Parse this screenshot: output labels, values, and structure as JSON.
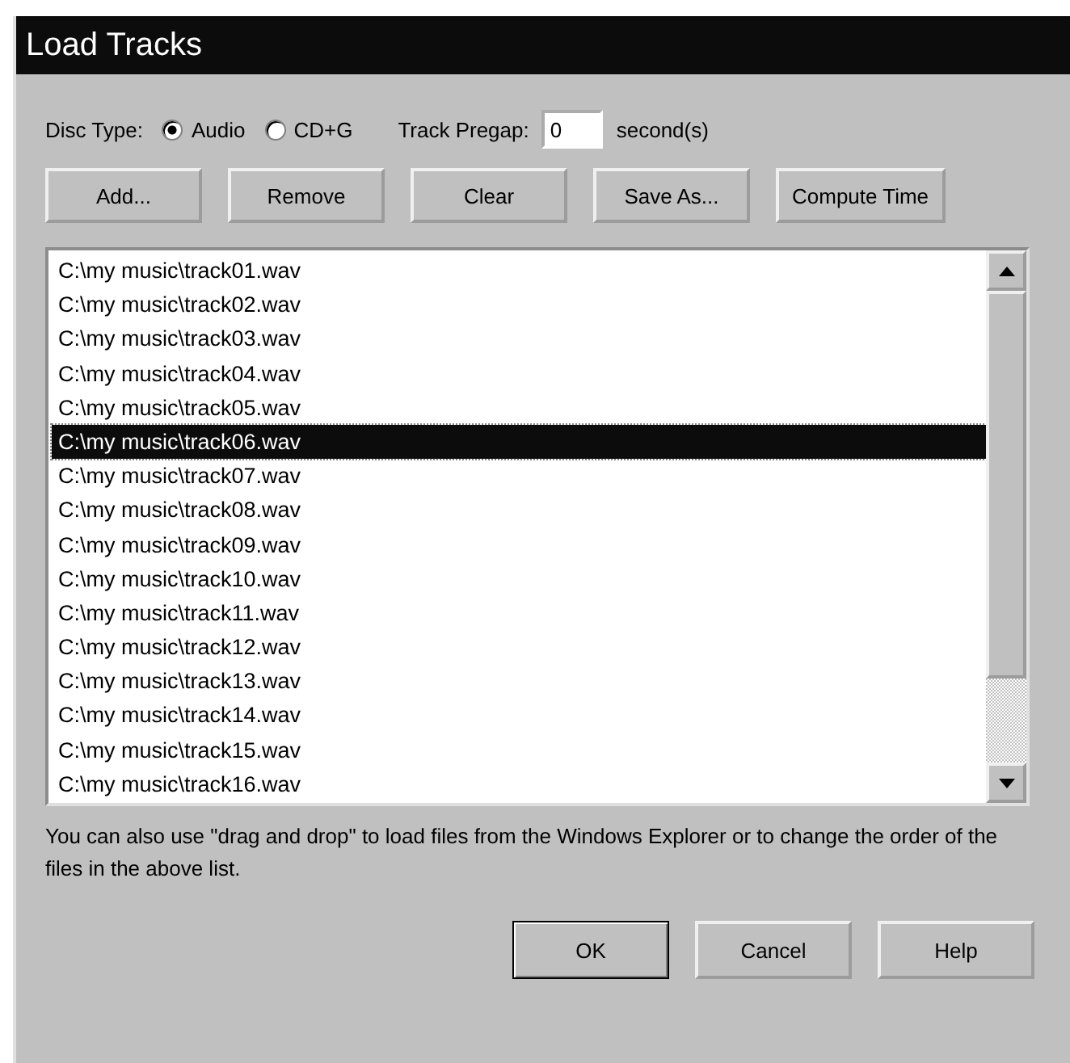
{
  "window": {
    "title": "Load Tracks"
  },
  "disc_type": {
    "label": "Disc Type:",
    "options": [
      {
        "label": "Audio",
        "selected": true
      },
      {
        "label": "CD+G",
        "selected": false
      }
    ]
  },
  "track_pregap": {
    "label": "Track Pregap:",
    "value": "0",
    "unit": "second(s)"
  },
  "toolbar_buttons": [
    "Add...",
    "Remove",
    "Clear",
    "Save As...",
    "Compute Time"
  ],
  "tracks": [
    {
      "path": "C:\\my music\\track01.wav",
      "selected": false
    },
    {
      "path": "C:\\my music\\track02.wav",
      "selected": false
    },
    {
      "path": "C:\\my music\\track03.wav",
      "selected": false
    },
    {
      "path": "C:\\my music\\track04.wav",
      "selected": false
    },
    {
      "path": "C:\\my music\\track05.wav",
      "selected": false
    },
    {
      "path": "C:\\my music\\track06.wav",
      "selected": true
    },
    {
      "path": "C:\\my music\\track07.wav",
      "selected": false
    },
    {
      "path": "C:\\my music\\track08.wav",
      "selected": false
    },
    {
      "path": "C:\\my music\\track09.wav",
      "selected": false
    },
    {
      "path": "C:\\my music\\track10.wav",
      "selected": false
    },
    {
      "path": "C:\\my music\\track11.wav",
      "selected": false
    },
    {
      "path": "C:\\my music\\track12.wav",
      "selected": false
    },
    {
      "path": "C:\\my music\\track13.wav",
      "selected": false
    },
    {
      "path": "C:\\my music\\track14.wav",
      "selected": false
    },
    {
      "path": "C:\\my music\\track15.wav",
      "selected": false
    },
    {
      "path": "C:\\my music\\track16.wav",
      "selected": false
    }
  ],
  "hint": "You can also use \"drag and drop\" to load files from the Windows Explorer or to change the order of the files in the above list.",
  "dialog_buttons": [
    {
      "label": "OK",
      "default": true
    },
    {
      "label": "Cancel",
      "default": false
    },
    {
      "label": "Help",
      "default": false
    }
  ]
}
